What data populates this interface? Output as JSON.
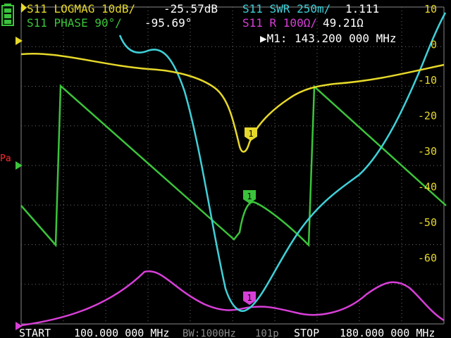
{
  "colors": {
    "background": "#000000",
    "grid": "#6e6e6e",
    "text": "#ffffff",
    "trace_logmag": "#e6d82a",
    "trace_phase": "#3bc43b",
    "trace_swr": "#3fd0d8",
    "trace_resistance": "#d83fd8",
    "battery": "#3bc43b",
    "pa_marker": "#ff2a2a"
  },
  "traces": [
    {
      "id": "logmag",
      "label": "S11 LOGMAG 10dB/",
      "value": "-25.57dB",
      "color": "#e6d82a"
    },
    {
      "id": "phase",
      "label": "S11 PHASE 90°/",
      "value": "-95.69°",
      "color": "#3bc43b"
    },
    {
      "id": "swr",
      "label": "S11 SWR 250m/",
      "value": "1.111",
      "color": "#3fd0d8"
    },
    {
      "id": "resistance",
      "label": "S11 R 100Ω/",
      "value": "49.21Ω",
      "color": "#d83fd8"
    }
  ],
  "marker": {
    "label": "▶M1:",
    "freq": "143.200 000 MHz",
    "number": "1"
  },
  "y_scale": [
    "10",
    "0",
    "-10",
    "-20",
    "-30",
    "-40",
    "-50",
    "-60"
  ],
  "left_indicator": "Pa",
  "footer": {
    "start_label": "START",
    "start_freq": "100.000 000 MHz",
    "bw": "BW:1000Hz",
    "points": "101p",
    "stop_label": "STOP",
    "stop_freq": "180.000 000 MHz"
  }
}
